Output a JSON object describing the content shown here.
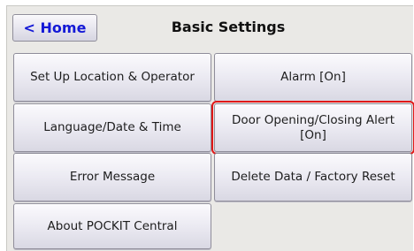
{
  "header": {
    "home_label": "< Home",
    "title": "Basic Settings"
  },
  "menu": {
    "setup_location_operator": "Set Up Location & Operator",
    "alarm": "Alarm [On]",
    "language_date_time": "Language/Date & Time",
    "door_alert_line1": "Door Opening/Closing Alert",
    "door_alert_line2": "[On]",
    "error_message": "Error Message",
    "delete_data_factory_reset": "Delete Data / Factory Reset",
    "about": "About POCKIT Central"
  },
  "colors": {
    "home_text": "#1419d6",
    "highlight": "#e01818",
    "background": "#eae9e6"
  }
}
